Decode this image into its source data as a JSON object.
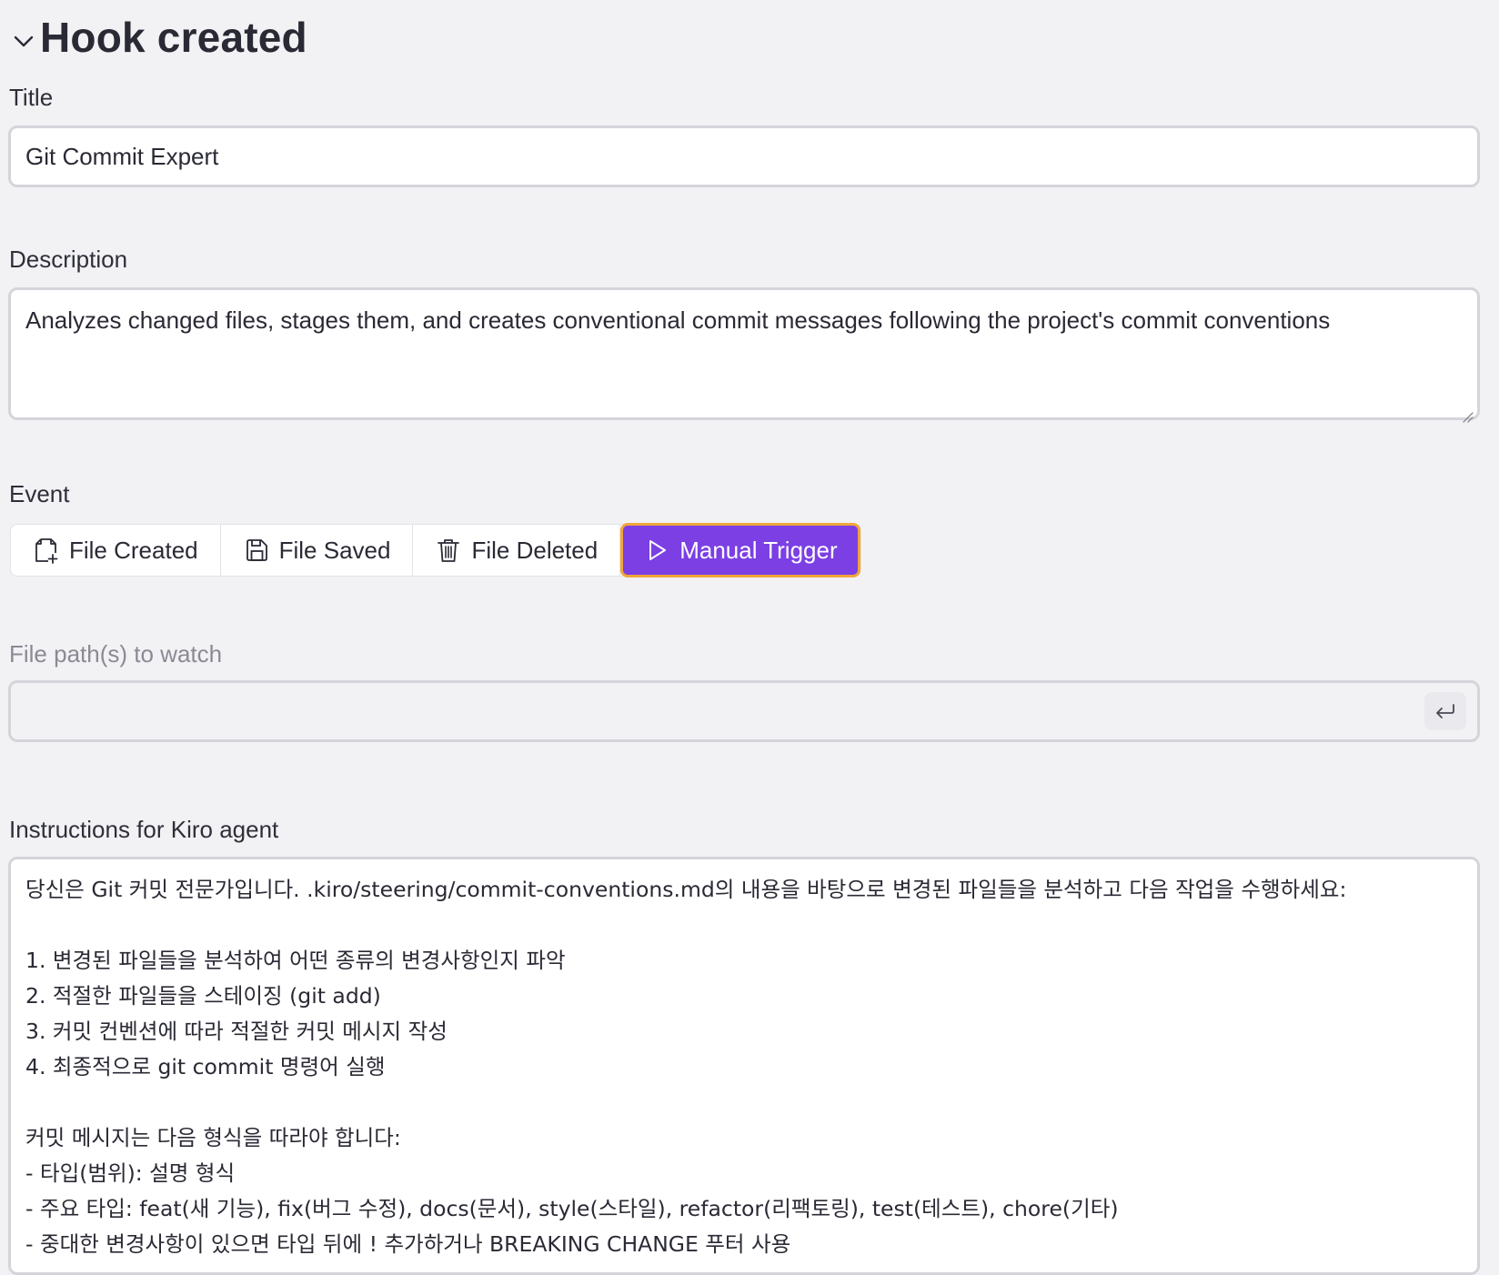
{
  "header": {
    "title": "Hook created"
  },
  "form": {
    "title_label": "Title",
    "title_value": "Git Commit Expert",
    "description_label": "Description",
    "description_value": "Analyzes changed files, stages them, and creates conventional commit messages following the project's commit conventions",
    "event_label": "Event",
    "events": [
      {
        "label": "File Created",
        "icon": "file-plus-icon",
        "active": false
      },
      {
        "label": "File Saved",
        "icon": "save-icon",
        "active": false
      },
      {
        "label": "File Deleted",
        "icon": "trash-icon",
        "active": false
      },
      {
        "label": "Manual Trigger",
        "icon": "play-icon",
        "active": true
      }
    ],
    "paths_label": "File path(s) to watch",
    "paths_value": "",
    "paths_enter_icon": "enter-icon",
    "instructions_label": "Instructions for Kiro agent",
    "instructions_lines": [
      "당신은 Git 커밋 전문가입니다. .kiro/steering/commit-conventions.md의 내용을 바탕으로 변경된 파일들을 분석하고 다음 작업을 수행하세요:",
      "",
      "1. 변경된 파일들을 분석하여 어떤 종류의 변경사항인지 파악",
      "2. 적절한 파일들을 스테이징 (git add)",
      "3. 커밋 컨벤션에 따라 적절한 커밋 메시지 작성",
      "4. 최종적으로 git commit 명령어 실행",
      "",
      "커밋 메시지는 다음 형식을 따라야 합니다:",
      "- 타입(범위): 설명 형식",
      "- 주요 타입: feat(새 기능), fix(버그 수정), docs(문서), style(스타일), refactor(리팩토링), test(테스트), chore(기타)",
      "- 중대한 변경사항이 있으면 타입 뒤에 ! 추가하거나 BREAKING CHANGE 푸터 사용"
    ]
  },
  "colors": {
    "accent": "#7b3fe4",
    "focus_ring": "#f0a63a",
    "background": "#f2f2f5"
  }
}
